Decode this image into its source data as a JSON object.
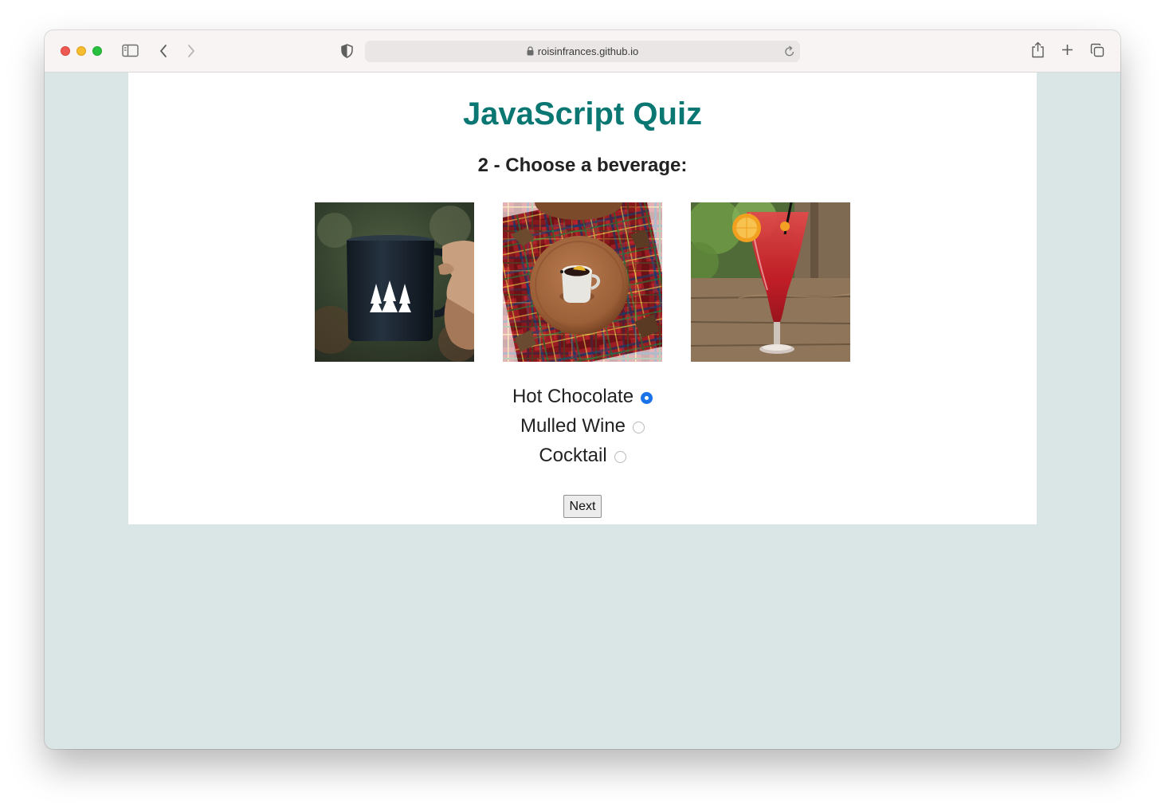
{
  "browser": {
    "url": "roisinfrances.github.io"
  },
  "page": {
    "title": "JavaScript Quiz",
    "question": "2 - Choose a beverage:",
    "images": [
      "hot-chocolate-mug-photo",
      "mulled-wine-photo",
      "cocktail-photo"
    ],
    "answers": [
      {
        "label": "Hot Chocolate",
        "checked": true
      },
      {
        "label": "Mulled Wine",
        "checked": false
      },
      {
        "label": "Cocktail",
        "checked": false
      }
    ],
    "next_label": "Next"
  },
  "colors": {
    "title": "#0b7773",
    "page_background": "#dae5e5",
    "radio_selected": "#1a73e8"
  }
}
